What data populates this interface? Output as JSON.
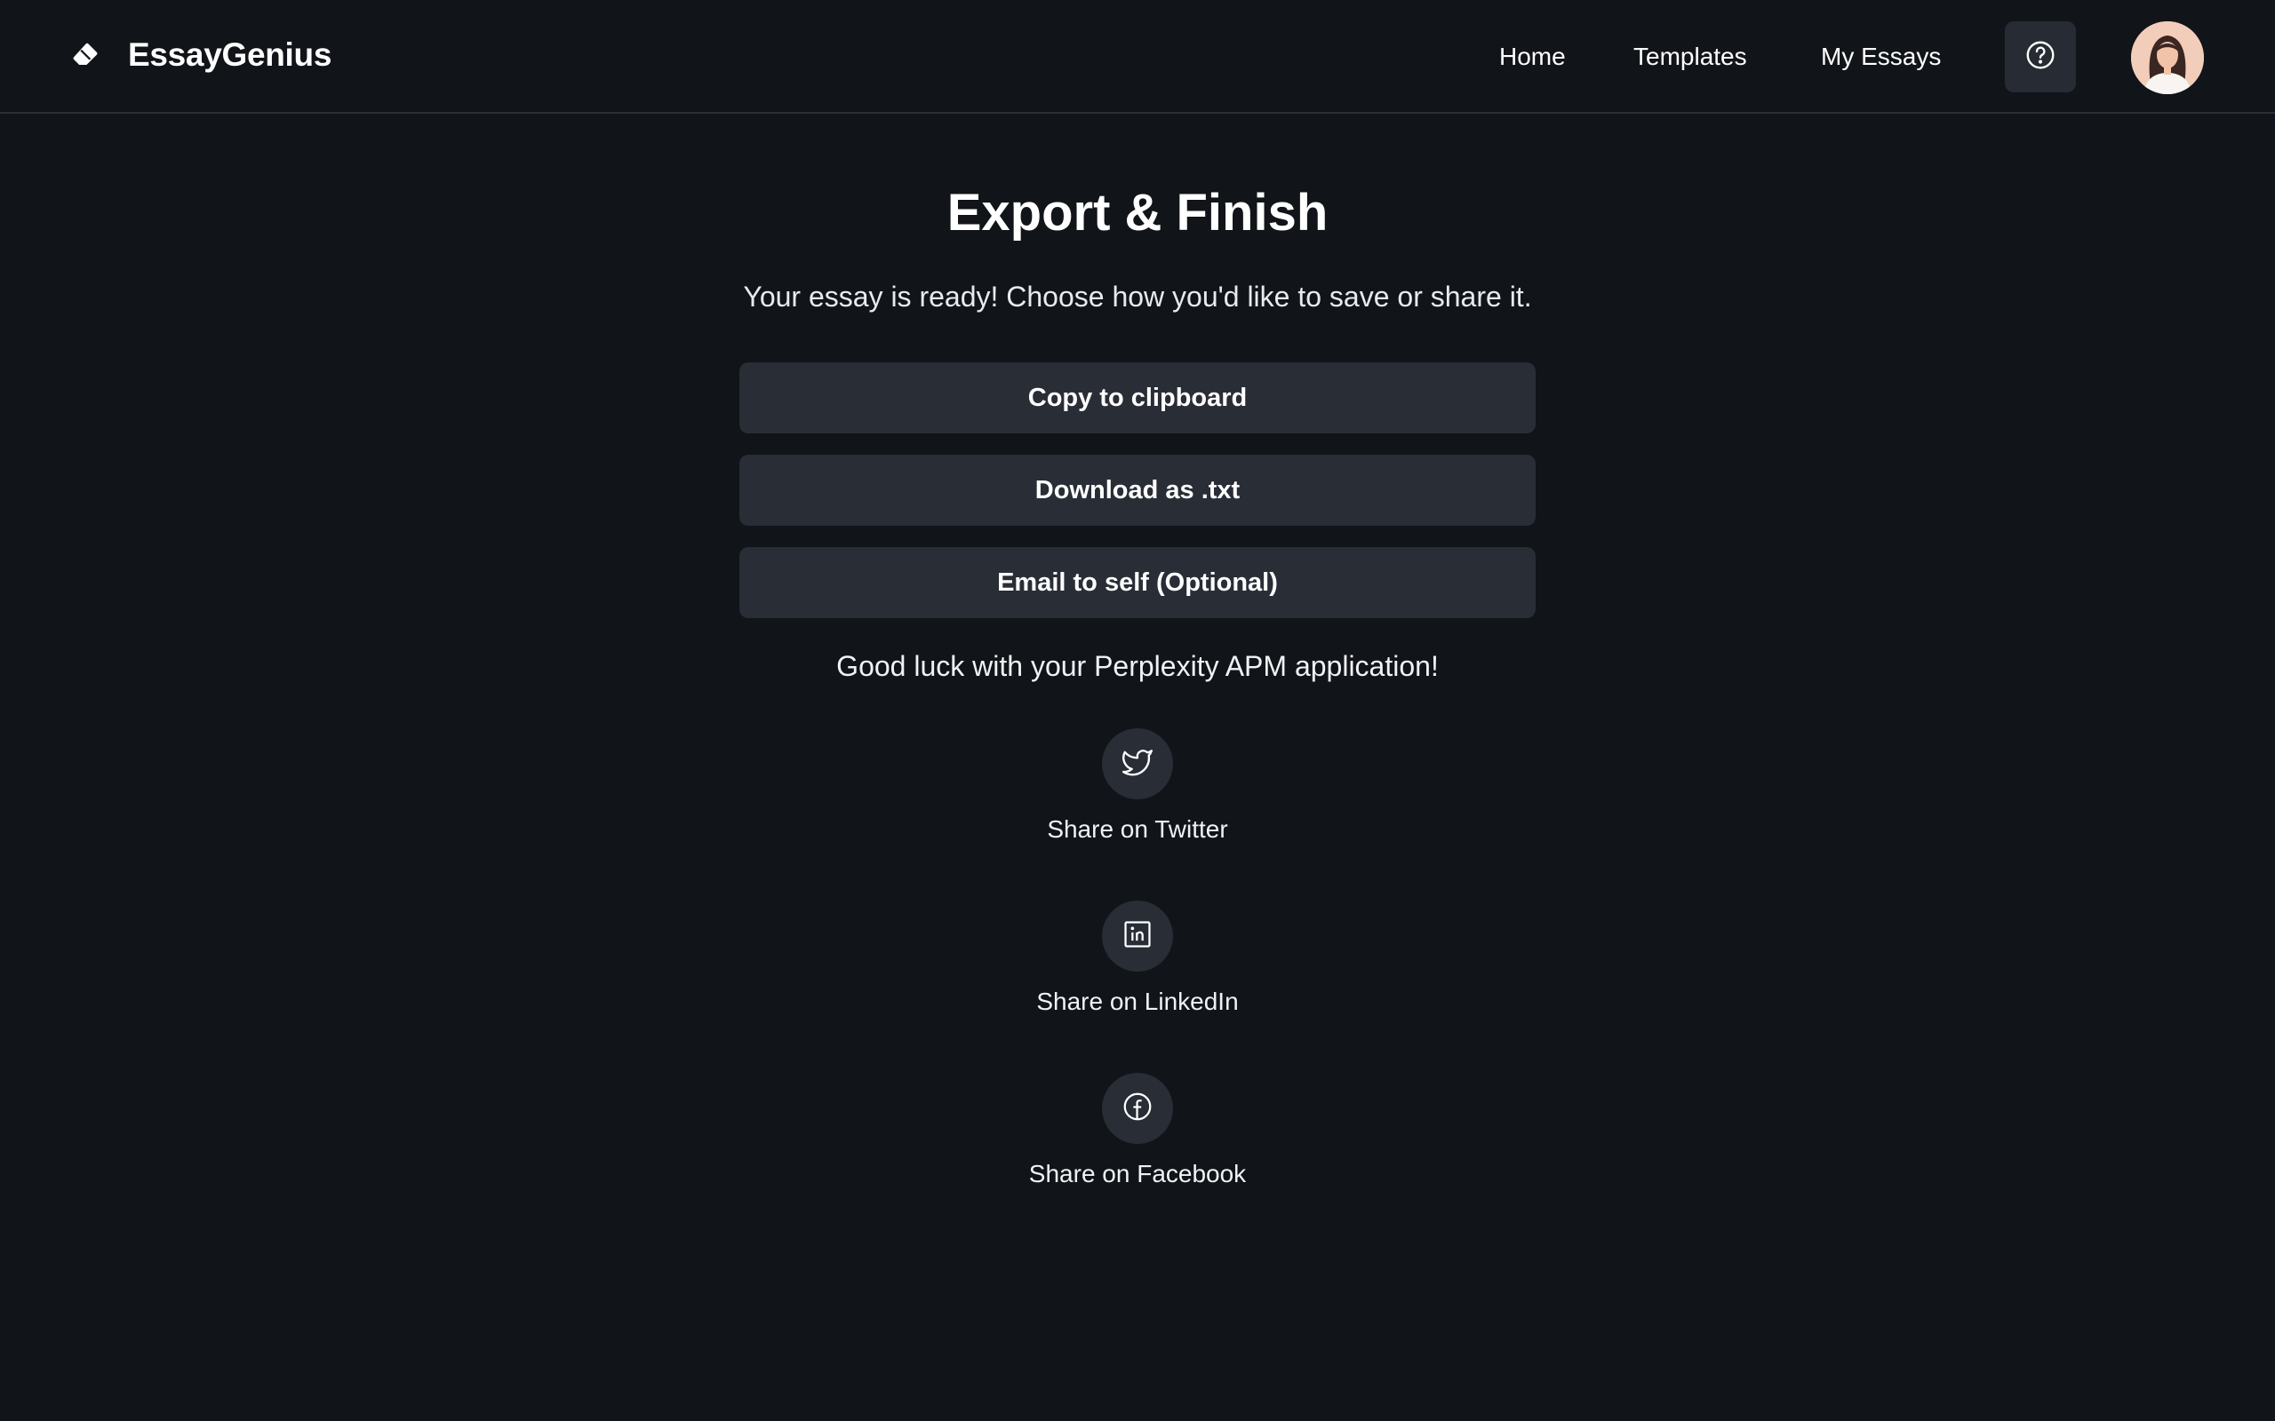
{
  "brand": {
    "name": "EssayGenius",
    "icon": "eraser-icon"
  },
  "nav": {
    "links": [
      "Home",
      "Templates",
      "My Essays"
    ],
    "help_icon": "question-circle-icon",
    "avatar": "user-avatar"
  },
  "main": {
    "title": "Export & Finish",
    "subtitle": "Your essay is ready! Choose how you'd like to save or share it.",
    "actions": [
      "Copy to clipboard",
      "Download as .txt",
      "Email to self (Optional)"
    ],
    "goodluck": "Good luck with your Perplexity APM application!"
  },
  "share": [
    {
      "label": "Share on Twitter",
      "icon": "twitter-icon"
    },
    {
      "label": "Share on LinkedIn",
      "icon": "linkedin-icon"
    },
    {
      "label": "Share on Facebook",
      "icon": "facebook-icon"
    }
  ],
  "colors": {
    "background": "#111418",
    "button": "#282d36",
    "border": "#2a2f37",
    "text": "#ffffff"
  }
}
